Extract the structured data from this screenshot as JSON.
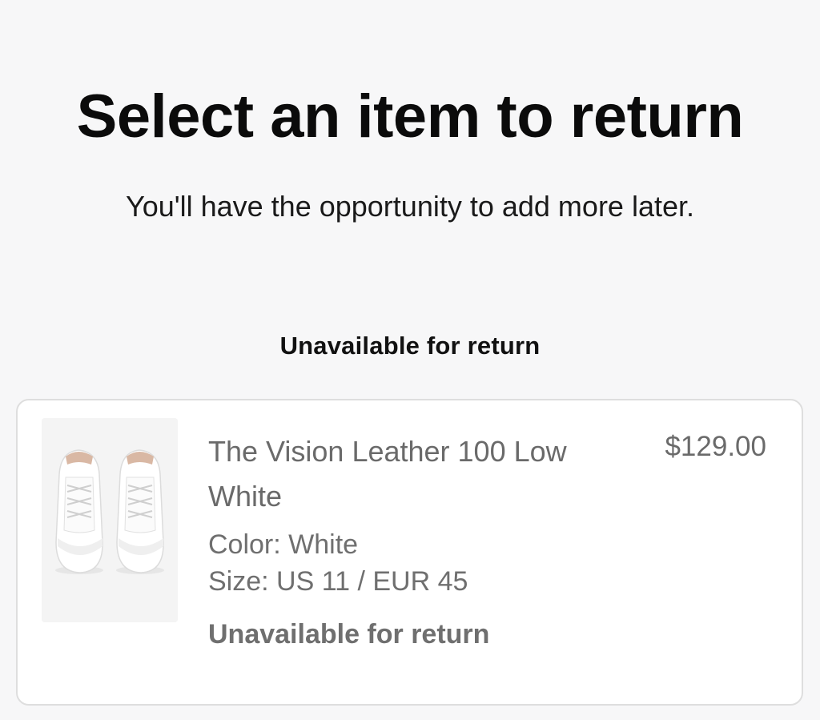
{
  "header": {
    "title": "Select an item to return",
    "subtitle": "You'll have the opportunity to add more later."
  },
  "section": {
    "heading": "Unavailable for return"
  },
  "item": {
    "name": "The Vision Leather 100 Low White",
    "price": "$129.00",
    "color": "Color: White",
    "size": "Size: US 11 / EUR 45",
    "status": "Unavailable for return",
    "image_icon": "white-sneakers-image"
  },
  "colors": {
    "background": "#f7f7f8",
    "card": "#ffffff",
    "card_border": "#dedede",
    "muted_text": "#6a6a6a",
    "heading_text": "#0b0b0b"
  }
}
